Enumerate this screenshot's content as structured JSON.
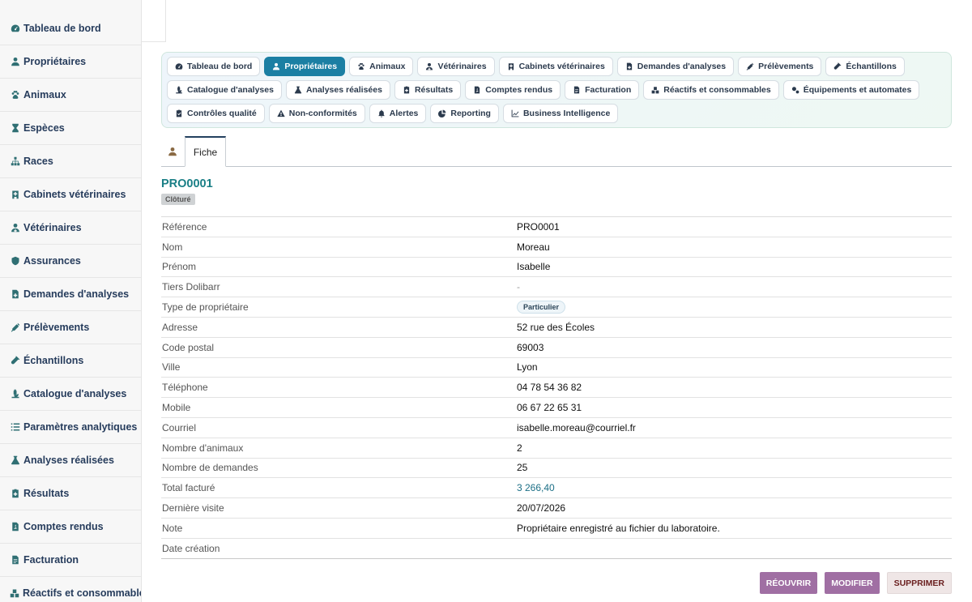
{
  "sidebar": {
    "items": [
      {
        "label": "Tableau de bord",
        "icon": "gauge-icon"
      },
      {
        "label": "Propriétaires",
        "icon": "user-icon"
      },
      {
        "label": "Animaux",
        "icon": "paw-icon"
      },
      {
        "label": "Espèces",
        "icon": "hourglass-icon"
      },
      {
        "label": "Races",
        "icon": "sitemap-icon"
      },
      {
        "label": "Cabinets vétérinaires",
        "icon": "hospital-icon"
      },
      {
        "label": "Vétérinaires",
        "icon": "doctor-icon"
      },
      {
        "label": "Assurances",
        "icon": "shield-icon"
      },
      {
        "label": "Demandes d'analyses",
        "icon": "file-medical-icon"
      },
      {
        "label": "Prélèvements",
        "icon": "syringe-icon"
      },
      {
        "label": "Échantillons",
        "icon": "vial-icon"
      },
      {
        "label": "Catalogue d'analyses",
        "icon": "microscope-icon"
      },
      {
        "label": "Paramètres analytiques",
        "icon": "list-icon"
      },
      {
        "label": "Analyses réalisées",
        "icon": "flask-icon"
      },
      {
        "label": "Résultats",
        "icon": "notes-medical-icon"
      },
      {
        "label": "Comptes rendus",
        "icon": "file-pdf-icon"
      },
      {
        "label": "Facturation",
        "icon": "invoice-icon"
      },
      {
        "label": "Réactifs et consommables",
        "icon": "boxes-icon"
      }
    ]
  },
  "tabs": [
    {
      "label": "Tableau de bord",
      "icon": "gauge-icon",
      "active": false
    },
    {
      "label": "Propriétaires",
      "icon": "user-icon",
      "active": true
    },
    {
      "label": "Animaux",
      "icon": "paw-icon",
      "active": false
    },
    {
      "label": "Vétérinaires",
      "icon": "doctor-icon",
      "active": false
    },
    {
      "label": "Cabinets vétérinaires",
      "icon": "hospital-icon",
      "active": false
    },
    {
      "label": "Demandes d'analyses",
      "icon": "file-medical-icon",
      "active": false
    },
    {
      "label": "Prélèvements",
      "icon": "syringe-icon",
      "active": false
    },
    {
      "label": "Échantillons",
      "icon": "vial-icon",
      "active": false
    },
    {
      "label": "Catalogue d'analyses",
      "icon": "microscope-icon",
      "active": false
    },
    {
      "label": "Analyses réalisées",
      "icon": "flask-icon",
      "active": false
    },
    {
      "label": "Résultats",
      "icon": "notes-medical-icon",
      "active": false
    },
    {
      "label": "Comptes rendus",
      "icon": "file-pdf-icon",
      "active": false
    },
    {
      "label": "Facturation",
      "icon": "invoice-icon",
      "active": false
    },
    {
      "label": "Réactifs et consommables",
      "icon": "boxes-icon",
      "active": false
    },
    {
      "label": "Équipements et automates",
      "icon": "cogs-icon",
      "active": false
    },
    {
      "label": "Contrôles qualité",
      "icon": "clipboard-check-icon",
      "active": false
    },
    {
      "label": "Non-conformités",
      "icon": "warning-icon",
      "active": false
    },
    {
      "label": "Alertes",
      "icon": "bell-icon",
      "active": false
    },
    {
      "label": "Reporting",
      "icon": "pie-chart-icon",
      "active": false
    },
    {
      "label": "Business Intelligence",
      "icon": "line-chart-icon",
      "active": false
    }
  ],
  "subtabs": {
    "icon": "user-icon",
    "active_label": "Fiche"
  },
  "record": {
    "title": "PRO0001",
    "status": "Clôturé",
    "fields": [
      {
        "label": "Référence",
        "value": "PRO0001",
        "kind": "text"
      },
      {
        "label": "Nom",
        "value": "Moreau",
        "kind": "text"
      },
      {
        "label": "Prénom",
        "value": "Isabelle",
        "kind": "text"
      },
      {
        "label": "Tiers Dolibarr",
        "value": "-",
        "kind": "muted"
      },
      {
        "label": "Type de propriétaire",
        "value": "Particulier",
        "kind": "pill"
      },
      {
        "label": "Adresse",
        "value": "52 rue des Écoles",
        "kind": "text"
      },
      {
        "label": "Code postal",
        "value": "69003",
        "kind": "text"
      },
      {
        "label": "Ville",
        "value": "Lyon",
        "kind": "text"
      },
      {
        "label": "Téléphone",
        "value": "04 78 54 36 82",
        "kind": "text"
      },
      {
        "label": "Mobile",
        "value": "06 67 22 65 31",
        "kind": "text"
      },
      {
        "label": "Courriel",
        "value": "isabelle.moreau@courriel.fr",
        "kind": "text"
      },
      {
        "label": "Nombre d'animaux",
        "value": "2",
        "kind": "text"
      },
      {
        "label": "Nombre de demandes",
        "value": "25",
        "kind": "text"
      },
      {
        "label": "Total facturé",
        "value": "3 266,40",
        "kind": "link"
      },
      {
        "label": "Dernière visite",
        "value": "20/07/2026",
        "kind": "text"
      },
      {
        "label": "Note",
        "value": "Propriétaire enregistré au fichier du laboratoire.",
        "kind": "text"
      },
      {
        "label": "Date création",
        "value": "",
        "kind": "text"
      }
    ]
  },
  "actions": {
    "reopen": "RÉOUVRIR",
    "modify": "MODIFIER",
    "delete": "SUPPRIMER"
  }
}
